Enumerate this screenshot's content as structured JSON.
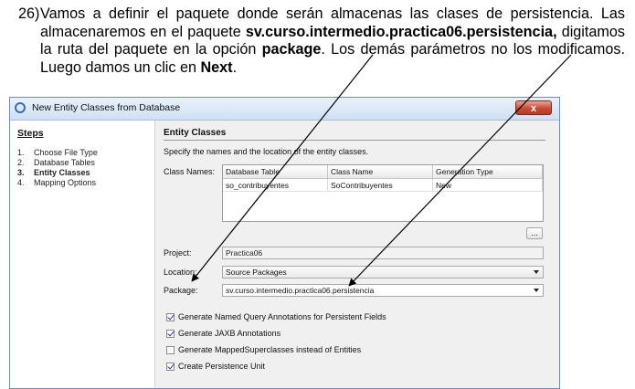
{
  "instruction": {
    "number": "26)",
    "text_1": "Vamos a definir el paquete donde serán almacenas las clases de persistencia. Las almacenaremos en el paquete ",
    "bold_package": "sv.curso.intermedio.practica06.persistencia,",
    "text_2": " digitamos la ruta del paquete en la opción ",
    "bold_option": "package",
    "text_3": ". Los demás parámetros no los modificamos. Luego damos un clic en ",
    "bold_next": "Next",
    "text_4": "."
  },
  "dialog": {
    "title": "New Entity Classes from Database",
    "close_label": "x",
    "steps": {
      "heading": "Steps",
      "items": [
        {
          "num": "1.",
          "label": "Choose File Type"
        },
        {
          "num": "2.",
          "label": "Database Tables"
        },
        {
          "num": "3.",
          "label": "Entity Classes"
        },
        {
          "num": "4.",
          "label": "Mapping Options"
        }
      ]
    },
    "panel": {
      "title": "Entity Classes",
      "description": "Specify the names and the location of the entity classes.",
      "class_names_label": "Class Names:",
      "table": {
        "headers": [
          "Database Table",
          "Class Name",
          "Generation Type"
        ],
        "rows": [
          [
            "so_contribuyentes",
            "SoContribuyentes",
            "New"
          ]
        ]
      },
      "ellipsis_label": "...",
      "project_label": "Project:",
      "project_value": "Practica06",
      "location_label": "Location:",
      "location_value": "Source Packages",
      "package_label": "Package:",
      "package_value": "sv.curso.intermedio.practica06.persistencia",
      "checkboxes": [
        {
          "label": "Generate Named Query Annotations for Persistent Fields",
          "checked": true
        },
        {
          "label": "Generate JAXB Annotations",
          "checked": true
        },
        {
          "label": "Generate MappedSuperclasses instead of Entities",
          "checked": false
        },
        {
          "label": "Create Persistence Unit",
          "checked": true
        }
      ]
    }
  },
  "colors": {
    "close_button": "#c94a32",
    "titlebar": "#cfe0f4",
    "arrows": "#000000"
  }
}
